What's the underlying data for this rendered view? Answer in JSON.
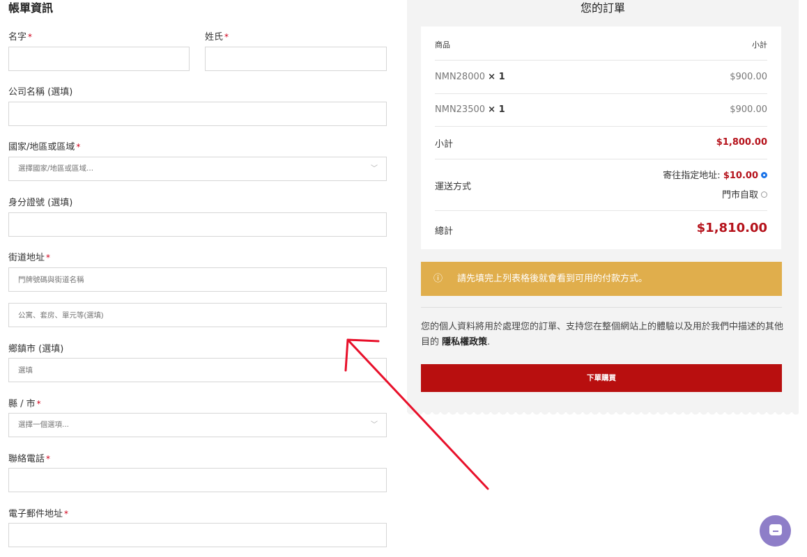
{
  "billing": {
    "title": "帳單資訊",
    "fields": {
      "first_name": {
        "label": "名字",
        "value": ""
      },
      "last_name": {
        "label": "姓氏",
        "value": ""
      },
      "company": {
        "label": "公司名稱 (選填)",
        "value": ""
      },
      "country": {
        "label": "國家/地區或區域",
        "placeholder": "選擇國家/地區或區域..."
      },
      "id_number": {
        "label": "身分證號 (選填)",
        "value": ""
      },
      "street": {
        "label": "街道地址",
        "placeholder": "門牌號碼與街道名稱"
      },
      "street2": {
        "placeholder": "公寓、套房、單元等(選填)"
      },
      "town": {
        "label": "鄉鎮市 (選填)",
        "placeholder": "選填"
      },
      "county": {
        "label": "縣 / 市",
        "placeholder": "選擇一個選項..."
      },
      "phone": {
        "label": "聯絡電話",
        "value": ""
      },
      "email": {
        "label": "電子郵件地址",
        "value": ""
      }
    },
    "required_mark": "*"
  },
  "order": {
    "title": "您的訂單",
    "header": {
      "product": "商品",
      "subtotal": "小計"
    },
    "items": [
      {
        "name": "NMN28000",
        "qty": "× 1",
        "price": "$900.00"
      },
      {
        "name": "NMN23500",
        "qty": "× 1",
        "price": "$900.00"
      }
    ],
    "subtotal": {
      "label": "小計",
      "value": "$1,800.00"
    },
    "shipping": {
      "label": "運送方式",
      "options": [
        {
          "label": "寄往指定地址:",
          "price": "$10.00",
          "selected": true
        },
        {
          "label": "門市自取",
          "selected": false
        }
      ]
    },
    "total": {
      "label": "總計",
      "value": "$1,810.00"
    }
  },
  "notice": {
    "icon": "info-circle-icon",
    "text": "請先填完上列表格後就會看到可用的付款方式。"
  },
  "privacy": {
    "text": "您的個人資料將用於處理您的訂單、支持您在整個網站上的體驗以及用於我們中描述的其他目的 ",
    "link": "隱私權政策",
    "suffix": "."
  },
  "place_order": {
    "label": "下單購買"
  },
  "colors": {
    "accent_red": "#b80f0f",
    "notice": "#e0ae4c",
    "annotation_arrow": "#e8102a"
  }
}
